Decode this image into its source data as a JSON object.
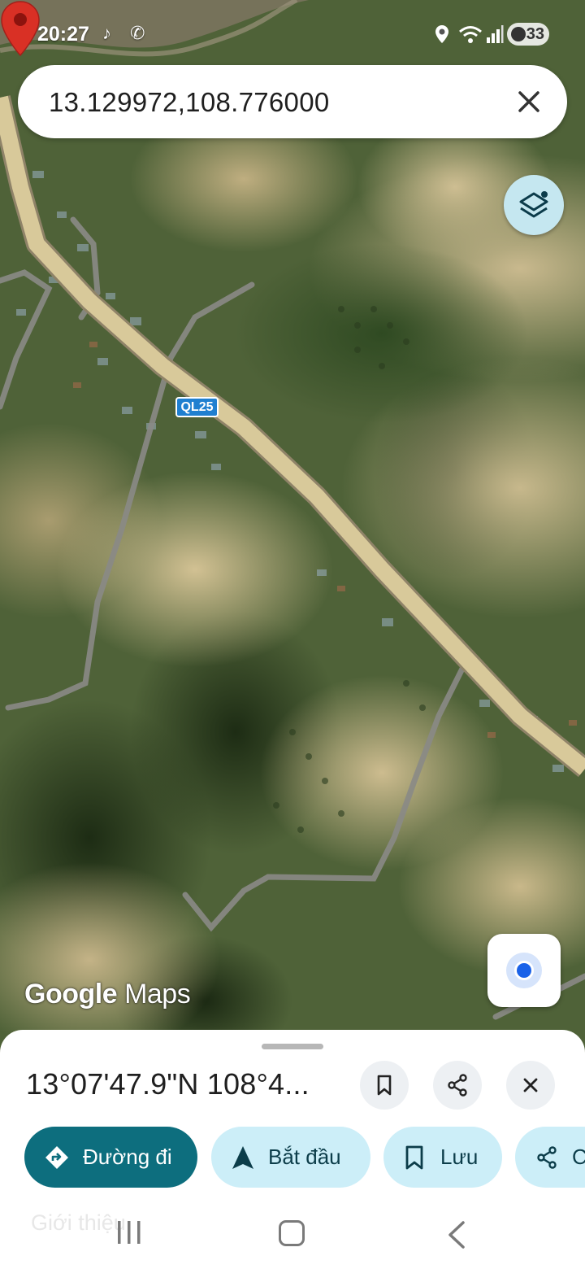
{
  "status_bar": {
    "time": "20:27",
    "battery": "33"
  },
  "search": {
    "query": "13.129972,108.776000"
  },
  "map": {
    "route_shield": "QL25",
    "watermark_google": "Google",
    "watermark_maps": "Maps",
    "pin_color": "#d93025",
    "road_color": "#d8c99a"
  },
  "place_sheet": {
    "coordinates": "13°07'47.9\"N 108°4...",
    "actions": [
      {
        "label": "Đường đi",
        "icon": "directions-icon"
      },
      {
        "label": "Bắt đầu",
        "icon": "navigation-arrow-icon"
      },
      {
        "label": "Lưu",
        "icon": "bookmark-icon"
      },
      {
        "label": "C",
        "icon": "share-icon"
      }
    ],
    "peek_text": "Giới thiệu"
  },
  "colors": {
    "primary_chip": "#0d6e7e",
    "secondary_chip": "#cceef8",
    "layers_button": "#c5e7f0"
  }
}
